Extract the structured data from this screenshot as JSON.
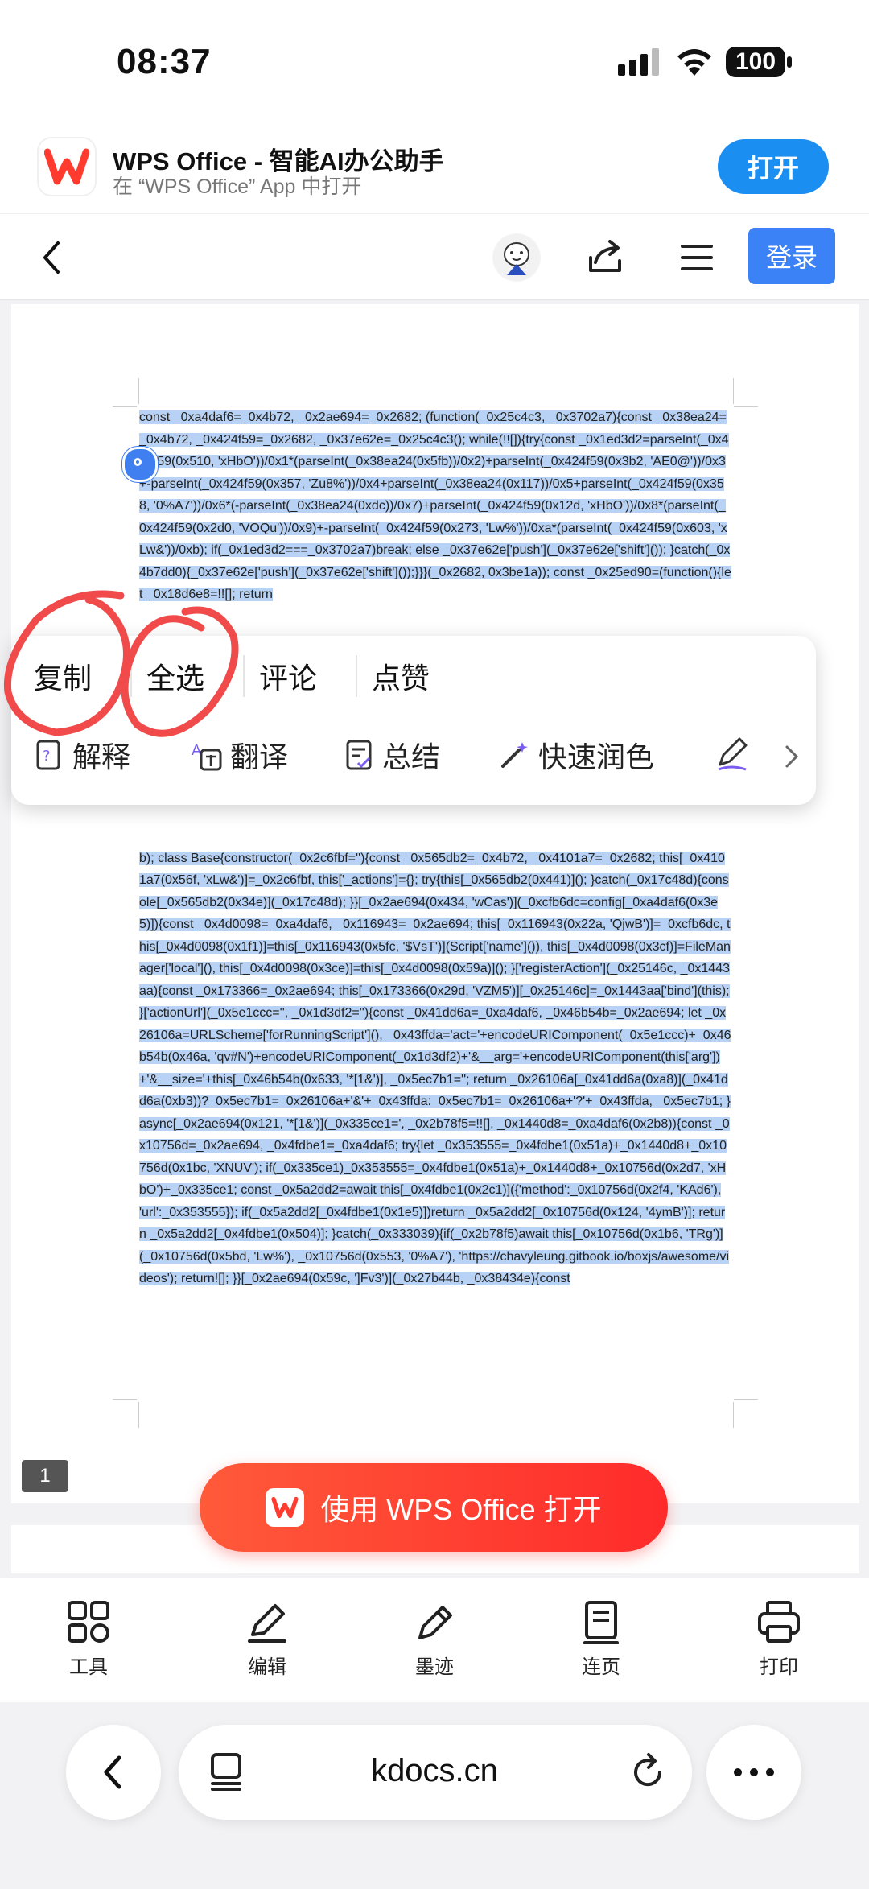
{
  "status_bar": {
    "time": "08:37",
    "battery": "100"
  },
  "app_banner": {
    "title": "WPS Office - 智能AI办公助手",
    "subtitle": "在 “WPS Office” App 中打开",
    "open_label": "打开"
  },
  "toolbar": {
    "login_label": "登录"
  },
  "document": {
    "text": "const          _0xa4daf6=_0x4b72, _0x2ae694=_0x2682; (function(_0x25c4c3, _0x3702a7){const _0x38ea24=_0x4b72, _0x424f59=_0x2682, _0x37e62e=_0x25c4c3(); while(!![]){try{const _0x1ed3d2=parseInt(_0x424f59(0x510, 'xHbO'))/0x1*(parseInt(_0x38ea24(0x5fb))/0x2)+parseInt(_0x424f59(0x3b2, 'AE0@'))/0x3+-parseInt(_0x424f59(0x357, 'Zu8%'))/0x4+parseInt(_0x38ea24(0x117))/0x5+parseInt(_0x424f59(0x358, '0%A7'))/0x6*(-parseInt(_0x38ea24(0xdc))/0x7)+parseInt(_0x424f59(0x12d, 'xHbO'))/0x8*(parseInt(_0x424f59(0x2d0, 'VOQu'))/0x9)+-parseInt(_0x424f59(0x273, 'Lw%'))/0xa*(parseInt(_0x424f59(0x603, 'xLw&'))/0xb); if(_0x1ed3d2===_0x3702a7)break; else _0x37e62e['push'](_0x37e62e['shift']()); }catch(_0x4b7dd0){_0x37e62e['push'](_0x37e62e['shift']());}}}(_0x2682, 0x3be1a)); const          _0x25ed90=(function(){let          _0x18d6e8=!![]; return",
    "text_bottom": "b); class                                     Base{constructor(_0x2c6fbf=''){const _0x565db2=_0x4b72, _0x4101a7=_0x2682; this[_0x4101a7(0x56f, 'xLw&')]=_0x2c6fbf, this['_actions']={}; try{this[_0x565db2(0x441)](); }catch(_0x17c48d){console[_0x565db2(0x34e)](_0x17c48d); }}[_0x2ae694(0x434, 'wCas')](_0xcfb6dc=config[_0xa4daf6(0x3e5)]){const _0x4d0098=_0xa4daf6, _0x116943=_0x2ae694; this[_0x116943(0x22a, 'QjwB')]=_0xcfb6dc, this[_0x4d0098(0x1f1)]=this[_0x116943(0x5fc, '$VsT')](Script['name']()), this[_0x4d0098(0x3cf)]=FileManager['local'](), this[_0x4d0098(0x3ce)]=this[_0x4d0098(0x59a)](); }['registerAction'](_0x25146c, _0x1443aa){const _0x173366=_0x2ae694; this[_0x173366(0x29d, 'VZM5')][_0x25146c]=_0x1443aa['bind'](this); }['actionUrl'](_0x5e1ccc='', _0x1d3df2=''){const _0x41dd6a=_0xa4daf6, _0x46b54b=_0x2ae694; let _0x26106a=URLScheme['forRunningScript'](), _0x43ffda='act='+encodeURIComponent(_0x5e1ccc)+_0x46b54b(0x46a, 'qv#N')+encodeURIComponent(_0x1d3df2)+'&__arg='+encodeURIComponent(this['arg'])+'&__size='+this[_0x46b54b(0x633, '*[1&')], _0x5ec7b1=''; return _0x26106a[_0x41dd6a(0xa8)](_0x41dd6a(0xb3))?_0x5ec7b1=_0x26106a+'&'+_0x43ffda:_0x5ec7b1=_0x26106a+'?'+_0x43ffda, _0x5ec7b1; }async[_0x2ae694(0x121, '*[1&')](_0x335ce1=', _0x2b78f5=!![], _0x1440d8=_0xa4daf6(0x2b8)){const _0x10756d=_0x2ae694, _0x4fdbe1=_0xa4daf6; try{let _0x353555=_0x4fdbe1(0x51a)+_0x1440d8+_0x10756d(0x1bc, 'XNUV'); if(_0x335ce1)_0x353555=_0x4fdbe1(0x51a)+_0x1440d8+_0x10756d(0x2d7, 'xHbO')+_0x335ce1; const _0x5a2dd2=await this[_0x4fdbe1(0x2c1)]({'method':_0x10756d(0x2f4, 'KAd6'), 'url':_0x353555}); if(_0x5a2dd2[_0x4fdbe1(0x1e5)])return                              _0x5a2dd2[_0x10756d(0x124, '4ymB')]; return _0x5a2dd2[_0x4fdbe1(0x504)]; }catch(_0x333039){if(_0x2b78f5)await this[_0x10756d(0x1b6, 'TRg')](_0x10756d(0x5bd, 'Lw%'), _0x10756d(0x553, '0%A7'), 'https://chavyleung.gitbook.io/boxjs/awesome/videos'); return![]; }}[_0x2ae694(0x59c, ']Fv3')](_0x27b44b, _0x38434e){const",
    "page_number": "1"
  },
  "popup": {
    "row1": [
      "复制",
      "全选",
      "评论",
      "点赞"
    ],
    "row2": [
      "解释",
      "翻译",
      "总结",
      "快速润色"
    ]
  },
  "open_wps_label": "使用 WPS Office 打开",
  "bottom_tools": [
    {
      "label": "工具",
      "icon": "grid-icon"
    },
    {
      "label": "编辑",
      "icon": "pencil-icon"
    },
    {
      "label": "墨迹",
      "icon": "ink-pen-icon"
    },
    {
      "label": "连页",
      "icon": "pages-icon"
    },
    {
      "label": "打印",
      "icon": "printer-icon"
    }
  ],
  "browser": {
    "url": "kdocs.cn"
  },
  "colors": {
    "accent_blue": "#1b8ef2",
    "wps_red": "#ff3b30",
    "selection": "#b7d2f4",
    "scribble_red": "#f04a4a"
  }
}
